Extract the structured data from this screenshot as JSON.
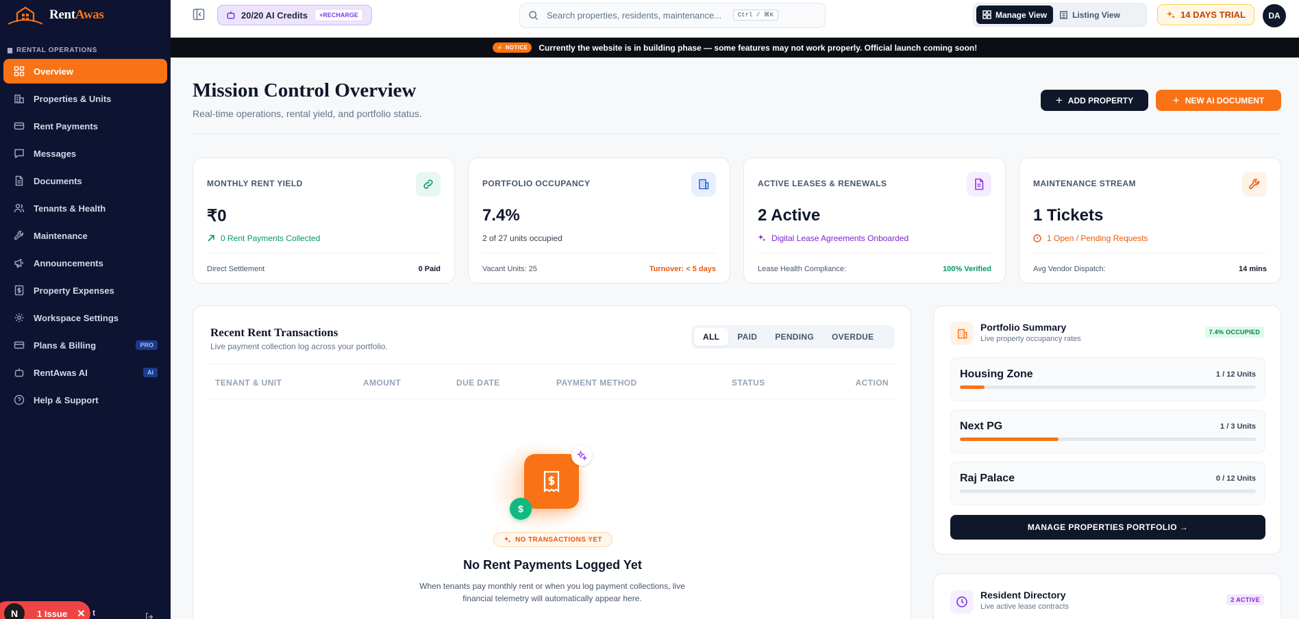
{
  "brand": {
    "name_a": "Rent",
    "name_b": "Awas"
  },
  "sidebar": {
    "section": "RENTAL OPERATIONS",
    "items": [
      {
        "label": "Overview",
        "active": true
      },
      {
        "label": "Properties & Units"
      },
      {
        "label": "Rent Payments"
      },
      {
        "label": "Messages"
      },
      {
        "label": "Documents"
      },
      {
        "label": "Tenants & Health"
      },
      {
        "label": "Maintenance"
      },
      {
        "label": "Announcements"
      },
      {
        "label": "Property Expenses"
      },
      {
        "label": "Workspace Settings"
      },
      {
        "label": "Plans & Billing",
        "badge": "PRO"
      },
      {
        "label": "RentAwas AI",
        "badge": "AI"
      },
      {
        "label": "Help & Support"
      }
    ],
    "issue": {
      "avatar": "N",
      "label": "1 Issue",
      "close": "✕"
    },
    "footer_text": "t"
  },
  "topbar": {
    "credits": "20/20 AI Credits",
    "recharge": "+RECHARGE",
    "search_placeholder": "Search properties, residents, maintenance...",
    "shortcut": "Ctrl / ⌘K",
    "manage_view": "Manage View",
    "listing_view": "Listing View",
    "trial": "14 DAYS TRIAL",
    "avatar": "DA"
  },
  "notice": {
    "badge": "⚡ NOTICE",
    "text": "Currently the website is in building phase — some features may not work properly. Official launch coming soon!"
  },
  "header": {
    "title": "Mission Control Overview",
    "subtitle": "Real-time operations, rental yield, and portfolio status.",
    "add_property": "ADD PROPERTY",
    "new_ai_document": "NEW AI DOCUMENT"
  },
  "stats": [
    {
      "label": "MONTHLY RENT YIELD",
      "value": "₹0",
      "sub": "0 Rent Payments Collected",
      "foot_l": "Direct Settlement",
      "foot_r": "0 Paid"
    },
    {
      "label": "PORTFOLIO OCCUPANCY",
      "value": "7.4%",
      "sub": "2 of 27 units occupied",
      "foot_l": "Vacant Units: 25",
      "foot_r": "Turnover: < 5 days"
    },
    {
      "label": "ACTIVE LEASES & RENEWALS",
      "value": "2 Active",
      "sub": "Digital Lease Agreements Onboarded",
      "foot_l": "Lease Health Compliance:",
      "foot_r": "100% Verified"
    },
    {
      "label": "MAINTENANCE STREAM",
      "value": "1 Tickets",
      "sub": "1 Open / Pending Requests",
      "foot_l": "Avg Vendor Dispatch:",
      "foot_r": "14 mins"
    }
  ],
  "transactions": {
    "title": "Recent Rent Transactions",
    "subtitle": "Live payment collection log across your portfolio.",
    "filters": [
      "ALL",
      "PAID",
      "PENDING",
      "OVERDUE"
    ],
    "columns": [
      "TENANT & UNIT",
      "AMOUNT",
      "DUE DATE",
      "PAYMENT METHOD",
      "STATUS",
      "ACTION"
    ],
    "empty_badge": "NO TRANSACTIONS YET",
    "empty_title": "No Rent Payments Logged Yet",
    "empty_desc": "When tenants pay monthly rent or when you log payment collections, live financial telemetry will automatically appear here."
  },
  "portfolio": {
    "title": "Portfolio Summary",
    "subtitle": "Live property occupancy rates",
    "badge": "7.4% OCCUPIED",
    "zones": [
      {
        "name": "Housing Zone",
        "units": "1 / 12 Units",
        "fill": 0.083
      },
      {
        "name": "Next PG",
        "units": "1 / 3 Units",
        "fill": 0.333
      },
      {
        "name": "Raj Palace",
        "units": "0 / 12 Units",
        "fill": 0
      }
    ],
    "button": "MANAGE PROPERTIES PORTFOLIO →"
  },
  "residents": {
    "title": "Resident Directory",
    "subtitle": "Live active lease contracts",
    "badge": "2 ACTIVE"
  },
  "colors": {
    "accent": "#f97316",
    "sidebar_bg": "#0d1330",
    "dark": "#0f172a",
    "success": "#047857"
  }
}
